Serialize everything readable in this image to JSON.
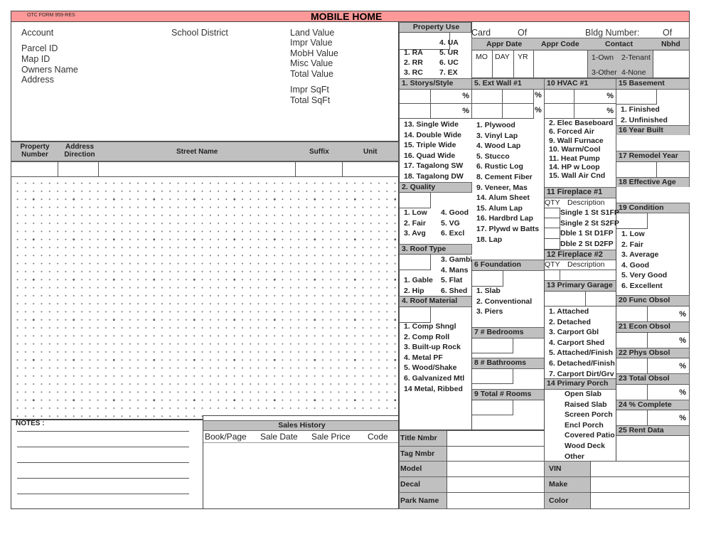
{
  "header": {
    "form_id": "OTC FORM 959-RES",
    "title": "MOBILE HOME",
    "bar_color": "#ff9999"
  },
  "owner": {
    "account": "Account",
    "parcel_id": "Parcel ID",
    "map_id": "Map ID",
    "owners_name": "Owners Name",
    "address": "Address",
    "school_district": "School District"
  },
  "values": {
    "land": "Land Value",
    "impr": "Impr Value",
    "mobh": "MobH Value",
    "misc": "Misc Value",
    "total": "Total Value",
    "impr_sqft": "Impr SqFt",
    "total_sqft": "Total SqFt"
  },
  "address_table": {
    "property_number": "Property Number",
    "address_direction": "Address Direction",
    "street_name": "Street Name",
    "suffix": "Suffix",
    "unit": "Unit"
  },
  "notes": {
    "label": "NOTES :"
  },
  "sales": {
    "title": "Sales History",
    "columns": [
      "Book/Page",
      "Sale Date",
      "Sale Price",
      "Code"
    ]
  },
  "property_use": {
    "title": "Property Use",
    "options": [
      "4. UA",
      "1. RA",
      "5. UR",
      "2. RR",
      "6. UC",
      "3. RC",
      "7. EX"
    ]
  },
  "card": {
    "card": "Card",
    "of1": "Of",
    "bldg": "Bldg Number:",
    "of2": "Of"
  },
  "appr": {
    "date": "Appr Date",
    "code": "Appr Code",
    "contact": "Contact",
    "nbhd": "Nbhd",
    "mo": "MO",
    "day": "DAY",
    "yr": "YR",
    "contact_options": [
      "1-Own",
      "2-Tenant",
      "3-Other",
      "4-None"
    ]
  },
  "storys": {
    "title": "1. Storys/Style",
    "options": [
      "13. Single Wide",
      "14. Double Wide",
      "15. Triple Wide",
      "16. Quad Wide",
      "17. Tagalong SW",
      "18. Tagalong DW"
    ]
  },
  "ext_wall": {
    "title": "5. Ext Wall #1",
    "options": [
      "1. Plywood",
      "3. Vinyl Lap",
      "4. Wood Lap",
      "5. Stucco",
      "6. Rustic Log",
      "8. Cement Fiber",
      "9. Veneer, Mas",
      "14. Alum Sheet",
      "15. Alum Lap",
      "16. Hardbrd Lap",
      "17. Plywd w Batts",
      "18. Lap"
    ]
  },
  "hvac": {
    "title": "10 HVAC #1",
    "options": [
      "2. Elec Baseboard",
      "6. Forced Air",
      "9. Wall Furnace",
      "10. Warm/Cool",
      "11. Heat Pump",
      "14. HP w Loop",
      "15. Wall Air Cnd"
    ]
  },
  "pct": "%",
  "basement": {
    "title": "15 Basement",
    "options": [
      "1. Finished",
      "2. Unfinished"
    ]
  },
  "year_built": {
    "title": "16 Year Built"
  },
  "remodel": {
    "title": "17 Remodel Year"
  },
  "eff_age": {
    "title": "18 Effective Age"
  },
  "condition": {
    "title": "19 Condition",
    "options": [
      "1. Low",
      "2. Fair",
      "3. Average",
      "4. Good",
      "5. Very Good",
      "6. Excellent"
    ]
  },
  "func_obsol": {
    "title": "20 Func Obsol"
  },
  "econ_obsol": {
    "title": "21 Econ Obsol"
  },
  "phys_obsol": {
    "title": "22 Phys Obsol"
  },
  "total_obsol": {
    "title": "23 Total Obsol"
  },
  "complete": {
    "title": "24  % Complete"
  },
  "rent": {
    "title": "25 Rent Data"
  },
  "quality": {
    "title": "2. Quality",
    "col1": [
      "1. Low",
      "2. Fair",
      "3. Avg"
    ],
    "col2": [
      "4. Good",
      "5. VG",
      "6. Excl"
    ]
  },
  "roof_type": {
    "title": "3. Roof Type",
    "options": [
      "3. Gambl",
      "4. Mans",
      "1. Gable",
      "5. Flat",
      "2. Hip",
      "6.  Shed"
    ]
  },
  "roof_material": {
    "title": "4. Roof Material",
    "options": [
      "1. Comp Shngl",
      "2. Comp Roll",
      "3. Built-up Rock",
      "4. Metal PF",
      "5. Wood/Shake",
      "6. Galvanized Mtl",
      "14 Metal, Ribbed"
    ]
  },
  "foundation": {
    "title": "6 Foundation",
    "options": [
      "1. Slab",
      "2. Conventional",
      "3. Piers"
    ]
  },
  "bedrooms": {
    "title": "7 # Bedrooms"
  },
  "bathrooms": {
    "title": "8 # Bathrooms"
  },
  "rooms": {
    "title": "9 Total # Rooms"
  },
  "fireplace1": {
    "title": "11 Fireplace #1",
    "qty": "QTY",
    "desc": "Description",
    "options": [
      "Single 1 St S1FP",
      "Single 2 St S2FP",
      "Dble 1 St D1FP",
      "Dble 2 St D2FP"
    ]
  },
  "fireplace2": {
    "title": "12 Fireplace #2",
    "qty": "QTY",
    "desc": "Description"
  },
  "garage": {
    "title": "13 Primary Garage",
    "options": [
      "1. Attached",
      "2. Detached",
      "3. Carport Gbl",
      "4. Carport Shed",
      "5. Attached/Finish",
      "6. Detached/Finish",
      "7. Carport Dirt/Grv"
    ]
  },
  "porch": {
    "title": "14 Primary Porch",
    "options": [
      "Open Slab",
      "Raised Slab",
      "Screen Porch",
      "Encl Porch",
      "Covered Patio",
      "Wood Deck",
      "Other"
    ]
  },
  "bottom": {
    "title_nmbr": "Title Nmbr",
    "tag_nmbr": "Tag Nmbr",
    "model": "Model",
    "decal": "Decal",
    "park_name": "Park Name",
    "vin": "VIN",
    "make": "Make",
    "color": "Color"
  }
}
